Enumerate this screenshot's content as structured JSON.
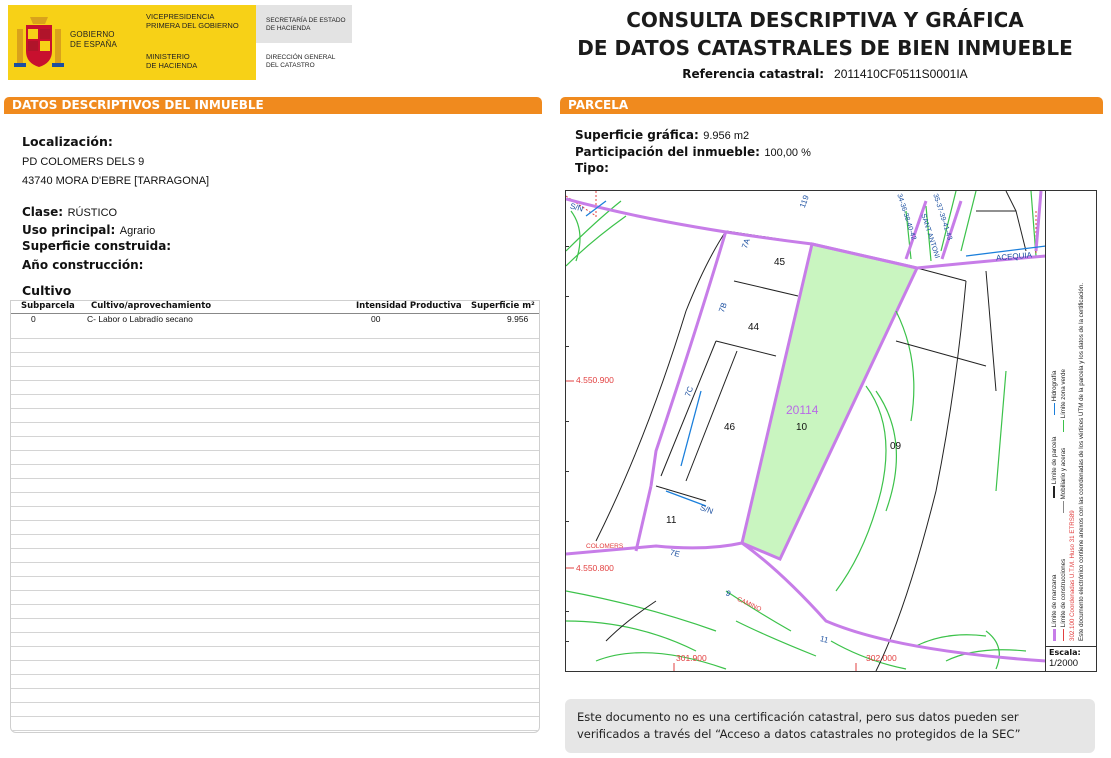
{
  "header": {
    "gov_line1": "GOBIERNO",
    "gov_line2": "DE ESPAÑA",
    "vice_line1": "VICEPRESIDENCIA",
    "vice_line2": "PRIMERA DEL GOBIERNO",
    "min_line1": "MINISTERIO",
    "min_line2": "DE HACIENDA",
    "sec_line1": "SECRETARÍA DE ESTADO",
    "sec_line2": "DE HACIENDA",
    "dir_line1": "DIRECCIÓN GENERAL",
    "dir_line2": "DEL CATASTRO",
    "title_line1": "CONSULTA DESCRIPTIVA Y GRÁFICA",
    "title_line2": "DE DATOS CATASTRALES DE BIEN INMUEBLE",
    "ref_label": "Referencia catastral:",
    "ref_value": "2011410CF0511S0001IA"
  },
  "left": {
    "section_title_a": "DATOS DESCRIPTIVOS DEL ",
    "section_title_b": "INMUEBLE",
    "loc_label": "Localización:",
    "loc_line1": "PD COLOMERS DELS 9",
    "loc_line2": "43740 MORA D'EBRE [TARRAGONA]",
    "clase_label": "Clase:",
    "clase_value": "RÚSTICO",
    "uso_label": "Uso principal:",
    "uso_value": "Agrario",
    "sup_label": "Superficie construida:",
    "anio_label": "Año construcción:",
    "cultivo_title": "Cultivo",
    "table": {
      "headers": [
        "Subparcela",
        "Cultivo/aprovechamiento",
        "Intensidad Productiva",
        "Superficie m²"
      ],
      "rows": [
        [
          "0",
          "C- Labor o Labradío secano",
          "00",
          "9.956"
        ]
      ]
    }
  },
  "right": {
    "section_title": "PARCELA",
    "supgraf_label": "Superficie gráfica:",
    "supgraf_value": "9.956 m2",
    "part_label": "Participación del inmueble:",
    "part_value": "100,00 %",
    "tipo_label": "Tipo:"
  },
  "map": {
    "labels": {
      "p45": "45",
      "p44": "44",
      "p46": "46",
      "p11": "11",
      "p09": "09",
      "p20114": "20114",
      "p10": "10",
      "sn1": "S/N",
      "sn2": "S/N",
      "r7a": "7A",
      "r7b": "7B",
      "r7c": "7C",
      "r7e": "7E",
      "r9": "9",
      "r11": "11",
      "r119": "119",
      "acequia": "ACEQUIA",
      "colomers": "COLOMERS",
      "camino": "CAMINO",
      "sant_antoni": "SANT ANTONI",
      "nums_a": "34-36-38-40-42",
      "nums_b": "35-37-39-41-43",
      "y_4550900": "4.550.900",
      "y_4550800": "4.550.800",
      "x_301900": "301.900",
      "x_302000": "302.000"
    },
    "legend": {
      "item1": "Límite de manzana",
      "item2": "Límite de construcciones",
      "item3": "Límite de parcela",
      "item4": "Mobiliario y aceras",
      "item5": "Hidrografía",
      "item6": "Límite zona verde",
      "coords": "302.100 Coordenadas U.T.M. Huso 31 ETRS89",
      "doc_note": "Este documento electrónico contiene anexos con las coordenadas de los vértices UTM de la parcela y los datos de la certificación."
    },
    "scale_label": "Escala:",
    "scale_value": "1/2000",
    "colors": {
      "parcel_fill": "#c9f5c0",
      "manzana": "#c77de8",
      "hidro": "#1b7fdb",
      "zona_verde": "#3cc24a"
    }
  },
  "note": {
    "text": "Este documento no es una certificación catastral, pero sus datos pueden ser verificados a través del “Acceso a datos catastrales no protegidos de la SEC”"
  }
}
